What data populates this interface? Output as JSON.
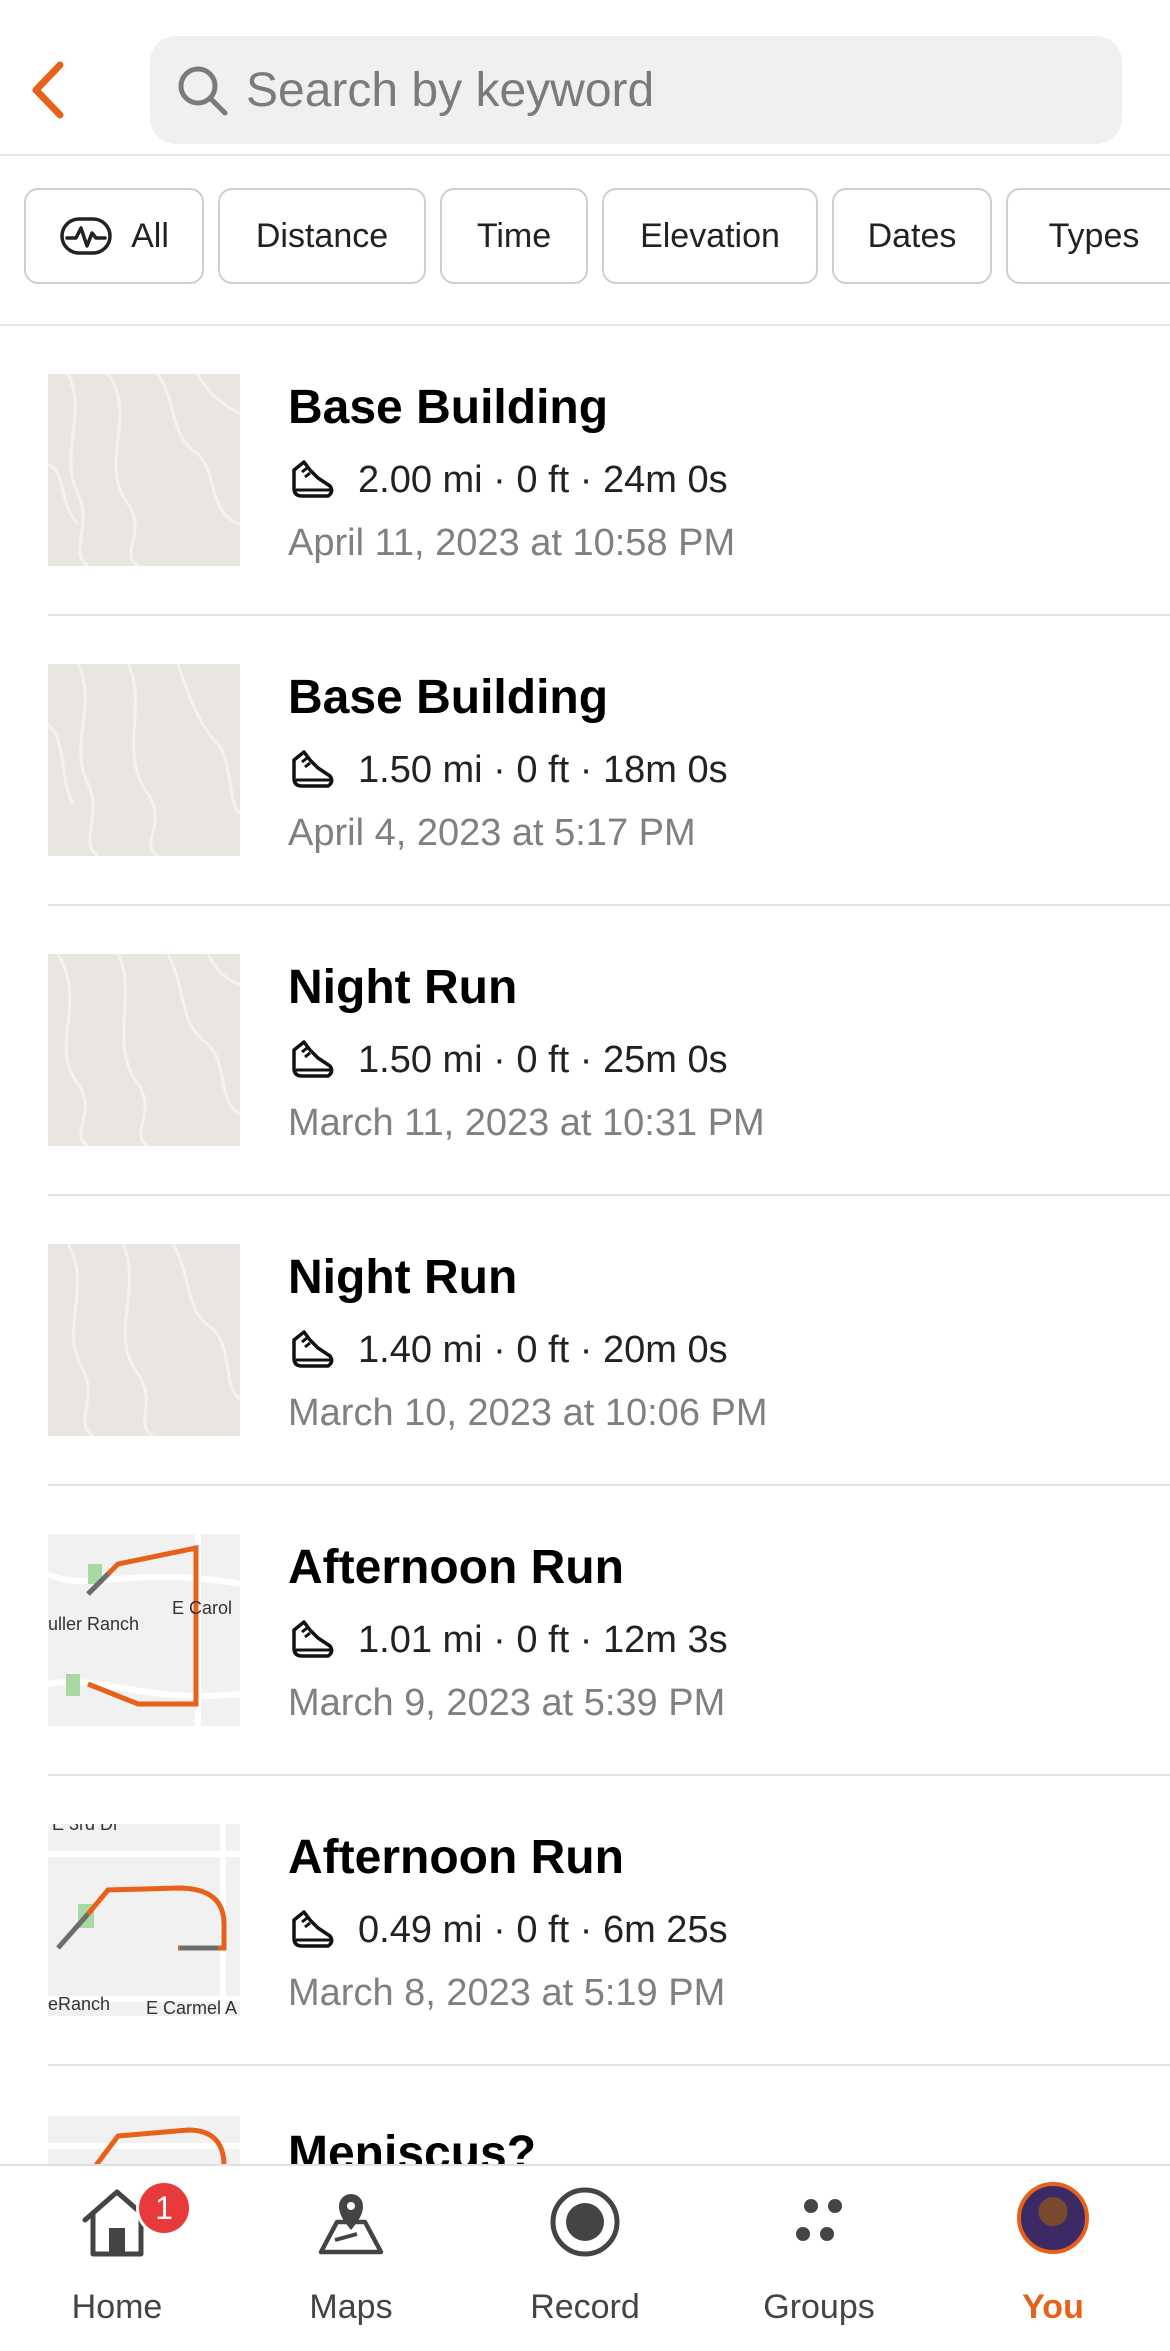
{
  "header": {
    "search_placeholder": "Search by keyword"
  },
  "filters": [
    {
      "label": "All",
      "selected": true
    },
    {
      "label": "Distance"
    },
    {
      "label": "Time"
    },
    {
      "label": "Elevation"
    },
    {
      "label": "Dates"
    },
    {
      "label": "Types"
    }
  ],
  "activities": [
    {
      "title": "Base Building",
      "stats": "2.00 mi · 0 ft · 24m 0s",
      "date": "April 11, 2023 at 10:58 PM",
      "map": "blank"
    },
    {
      "title": "Base Building",
      "stats": "1.50 mi · 0 ft · 18m 0s",
      "date": "April 4, 2023 at 5:17 PM",
      "map": "blank"
    },
    {
      "title": "Night Run",
      "stats": "1.50 mi · 0 ft · 25m 0s",
      "date": "March 11, 2023 at 10:31 PM",
      "map": "blank"
    },
    {
      "title": "Night Run",
      "stats": "1.40 mi · 0 ft · 20m 0s",
      "date": "March 10, 2023 at 10:06 PM",
      "map": "blank"
    },
    {
      "title": "Afternoon Run",
      "stats": "1.01 mi · 0 ft · 12m 3s",
      "date": "March 9, 2023 at 5:39 PM",
      "map": "route",
      "map_labels": [
        "uller Ranch",
        "E Carol"
      ]
    },
    {
      "title": "Afternoon Run",
      "stats": "0.49 mi · 0 ft · 6m 25s",
      "date": "March 8, 2023 at 5:19 PM",
      "map": "route",
      "map_labels": [
        "E 3rd Dr",
        "eRanch",
        "E Carmel A"
      ]
    },
    {
      "title": "Meniscus?",
      "stats": "",
      "date": "",
      "map": "route"
    }
  ],
  "tabbar": {
    "home": {
      "label": "Home",
      "badge": "1"
    },
    "maps": {
      "label": "Maps"
    },
    "record": {
      "label": "Record"
    },
    "groups": {
      "label": "Groups"
    },
    "you": {
      "label": "You",
      "active": true
    }
  },
  "colors": {
    "accent": "#e8611a",
    "badge": "#e83a3a",
    "route": "#e8611a"
  }
}
